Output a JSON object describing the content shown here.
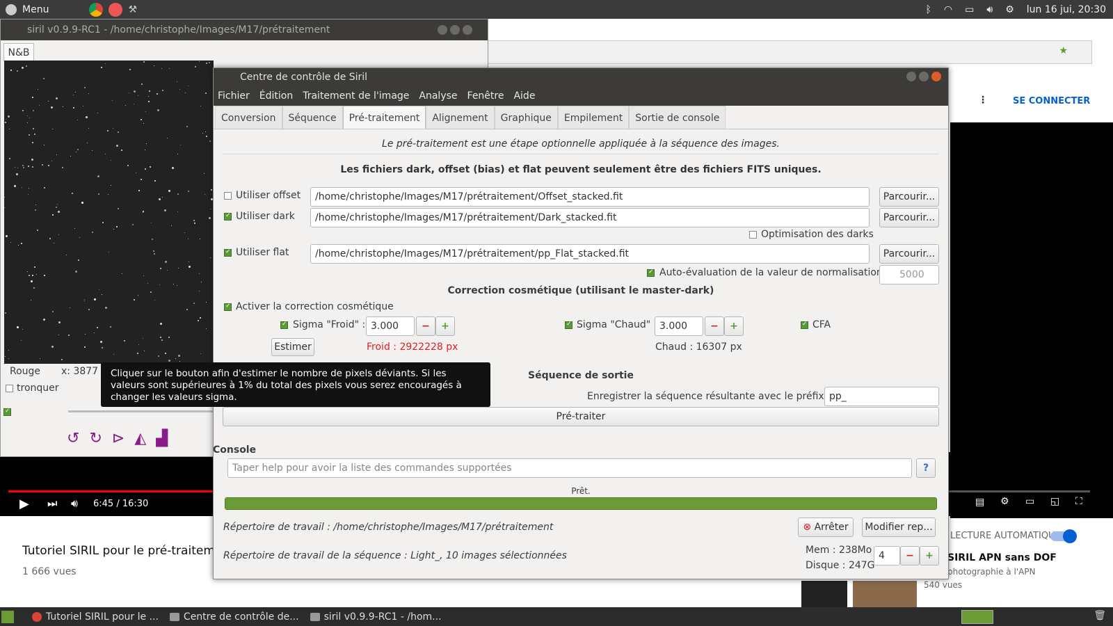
{
  "topbar": {
    "menu": "Menu",
    "clock": "lun 16 jui, 20:30"
  },
  "siril_main": {
    "title": "siril v0.9.9-RC1 - /home/christophe/Images/M17/prétraitement",
    "mode": "N&B",
    "channel": "Rouge",
    "coord": "x: 3877",
    "tronquer": "tronquer"
  },
  "youtube": {
    "connect": "SE CONNECTER",
    "time": "6:45 / 16:30",
    "video_title": "Tutoriel SIRIL pour le pré-traitemen",
    "views": "1 666 vues",
    "autoplay": "LECTURE AUTOMATIQUE",
    "next_title": "SIRIL APN sans DOF",
    "next_sub": "photographie à l'APN",
    "next_views": "540 vues"
  },
  "ctrl": {
    "title": "Centre de contrôle de Siril",
    "menus": [
      "Fichier",
      "Édition",
      "Traitement de l'image",
      "Analyse",
      "Fenêtre",
      "Aide"
    ],
    "tabs": [
      "Conversion",
      "Séquence",
      "Pré-traitement",
      "Alignement",
      "Graphique",
      "Empilement",
      "Sortie de console"
    ],
    "intro": "Le pré-traitement est une étape optionnelle appliquée à la séquence des images.",
    "note": "Les fichiers dark, offset (bias) et flat peuvent seulement être des fichiers FITS uniques.",
    "offset_label": "Utiliser offset",
    "offset_path": "/home/christophe/Images/M17/prétraitement/Offset_stacked.fit",
    "dark_label": "Utiliser dark",
    "dark_path": "/home/christophe/Images/M17/prétraitement/Dark_stacked.fit",
    "dark_opt": "Optimisation des darks",
    "flat_label": "Utiliser flat",
    "flat_path": "/home/christophe/Images/M17/prétraitement/pp_Flat_stacked.fit",
    "browse": "Parcourir...",
    "auto_norm": "Auto-évaluation de la valeur de normalisation",
    "norm_value": "5000",
    "cosmetic_title": "Correction cosmétique (utilisant le master-dark)",
    "cosmetic_enable": "Activer la correction cosmétique",
    "sigma_cold_label": "Sigma \"Froid\" :",
    "sigma_cold": "3.000",
    "sigma_hot_label": "Sigma \"Chaud\" :",
    "sigma_hot": "3.000",
    "cfa": "CFA",
    "estimate": "Estimer",
    "cold_result": "Froid : 2922228 px",
    "hot_result": "Chaud : 16307 px",
    "output_title": "Séquence de sortie",
    "prefix_label": "Enregistrer la séquence résultante avec le préfixe :",
    "prefix": "pp_",
    "preprocess": "Pré-traiter",
    "console": "Console",
    "console_placeholder": "Taper help pour avoir la liste des commandes supportées",
    "status": "Prêt.",
    "progress": 1.0,
    "workdir": "Répertoire de travail : /home/christophe/Images/M17/prétraitement",
    "stop": "Arrêter",
    "change_dir": "Modifier rep...",
    "seqdir": "Répertoire de travail de la séquence : Light_, 10 images sélectionnées",
    "mem": "Mem : 238Mo",
    "disk": "Disque : 247G",
    "threads": "4"
  },
  "tooltip": "Cliquer sur le bouton afin d'estimer le nombre de pixels déviants. Si les valeurs sont supérieures à 1% du total des pixels vous serez encouragés à changer les valeurs sigma.",
  "taskbar": [
    "Tutoriel SIRIL pour le ...",
    "Centre de contrôle de...",
    "siril v0.9.9-RC1 - /hom..."
  ],
  "colors": {
    "accent_green": "#6a9b34",
    "red": "#e02020",
    "yt_blue": "#065fd4"
  }
}
